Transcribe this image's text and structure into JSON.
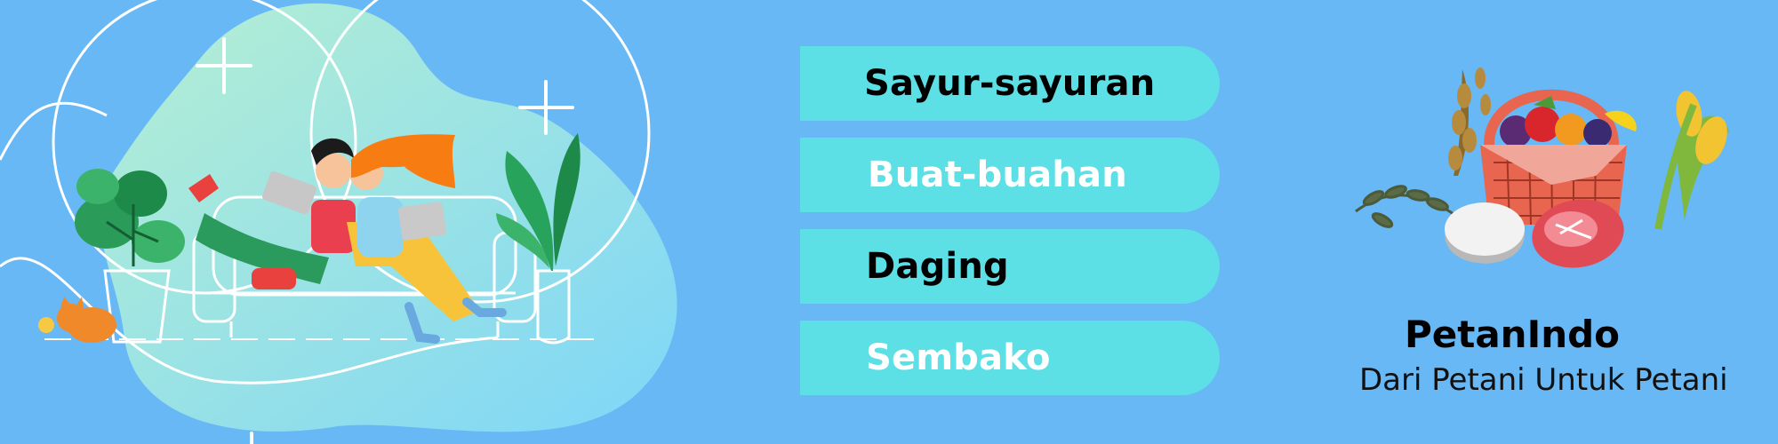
{
  "menu": {
    "items": [
      {
        "label": "Sayur-sayuran",
        "text_color": "#000000"
      },
      {
        "label": "Buat-buahan",
        "text_color": "#ffffff"
      },
      {
        "label": "Daging",
        "text_color": "#000000"
      },
      {
        "label": "Sembako",
        "text_color": "#ffffff"
      }
    ]
  },
  "brand": {
    "title": "PetanIndo",
    "tagline": "Dari Petani Untuk Petani"
  },
  "colors": {
    "background": "#67b8f5",
    "menu_button": "#5ce0e6",
    "basket": "#e8664f",
    "blob_light": "#b3ecd6",
    "blob_blue": "#7fd8f7"
  }
}
